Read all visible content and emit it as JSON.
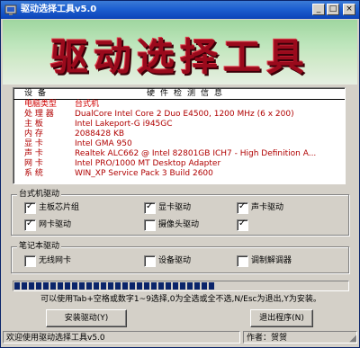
{
  "window": {
    "title": "驱动选择工具v5.0",
    "controls": {
      "minimize": "_",
      "maximize": "□",
      "close": "×"
    }
  },
  "banner": {
    "title": "驱动选择工具"
  },
  "info_panel": {
    "header": {
      "left": "设备",
      "right": "硬件检测信息"
    },
    "rows": [
      {
        "label": "电脑类型",
        "value": "台式机"
      },
      {
        "label": "处 理 器",
        "value": "DualCore Intel Core 2 Duo E4500, 1200 MHz (6 x 200)"
      },
      {
        "label": "主    板",
        "value": "Intel Lakeport-G i945GC"
      },
      {
        "label": "内    存",
        "value": "2088428 KB"
      },
      {
        "label": "显    卡",
        "value": "Intel GMA 950"
      },
      {
        "label": "声    卡",
        "value": "Realtek ALC662 @ Intel 82801GB ICH7 - High Definition A..."
      },
      {
        "label": "网    卡",
        "value": "Intel PRO/1000 MT Desktop Adapter"
      },
      {
        "label": "系    统",
        "value": "WIN_XP Service Pack 3 Build 2600"
      }
    ]
  },
  "desktop_group": {
    "label": "台式机驱动",
    "items": [
      {
        "label": "主板芯片组",
        "checked": true
      },
      {
        "label": "显卡驱动",
        "checked": true
      },
      {
        "label": "声卡驱动",
        "checked": true
      },
      {
        "label": "网卡驱动",
        "checked": true
      },
      {
        "label": "摄像头驱动",
        "checked": false
      },
      {
        "label": "",
        "checked": true
      }
    ]
  },
  "laptop_group": {
    "label": "笔记本驱动",
    "items": [
      {
        "label": "无线网卡",
        "checked": false
      },
      {
        "label": "设备驱动",
        "checked": false
      },
      {
        "label": "调制解调器",
        "checked": false
      }
    ]
  },
  "progress": {
    "value": 0.6
  },
  "hint": "可以使用Tab+空格或数字1~9选择,0为全选或全不选,N/Esc为退出,Y为安装。",
  "buttons": {
    "install": "安装驱动(Y)",
    "exit": "退出程序(N)"
  },
  "statusbar": {
    "left": "欢迎使用驱动选择工具v5.0",
    "right": "作者：贺贺"
  },
  "colors": {
    "title_bar": "#1d5fd0",
    "banner_text": "#9a0a1c",
    "info_text": "#b00000",
    "progress_fill": "#0a246a"
  }
}
